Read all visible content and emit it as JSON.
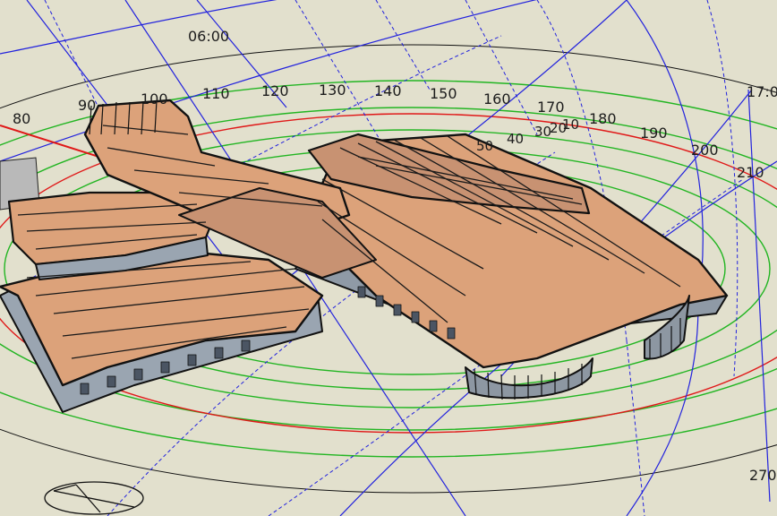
{
  "view": {
    "time_label": "06:00",
    "azimuth_labels": [
      "80",
      "90",
      "100",
      "110",
      "120",
      "130",
      "140",
      "150",
      "160",
      "170",
      "180",
      "190",
      "200",
      "210",
      "270"
    ],
    "altitude_labels": [
      "50",
      "40",
      "30",
      "20",
      "10"
    ],
    "cut_label": "17:0"
  },
  "colors": {
    "background": "#e2e0cd",
    "sun_path": "#2222dd",
    "altitude_rings": "#22b522",
    "horizon_ring": "#e01818",
    "roof": "#dca27a",
    "roof_dark": "#b77e59",
    "wall": "#8f9aa6",
    "edges": "#111111"
  },
  "icons": [
    "compass-icon"
  ]
}
